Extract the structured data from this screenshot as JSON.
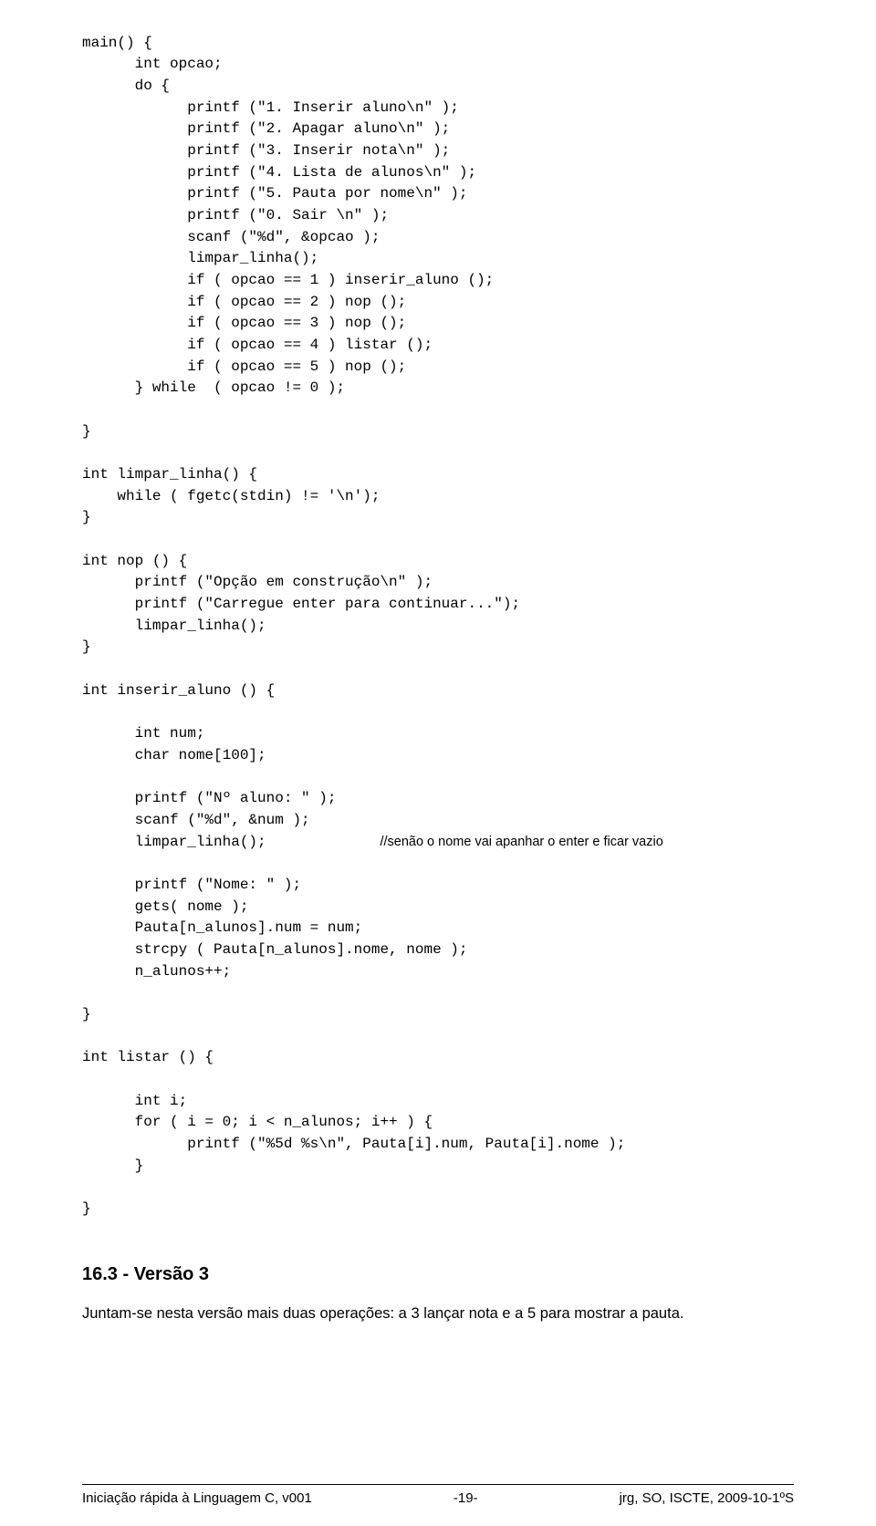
{
  "code": {
    "line01": "main() {",
    "line02": "      int opcao;",
    "line03": "      do {",
    "line04": "            printf (\"1. Inserir aluno\\n\" );",
    "line05": "            printf (\"2. Apagar aluno\\n\" );",
    "line06": "            printf (\"3. Inserir nota\\n\" );",
    "line07": "            printf (\"4. Lista de alunos\\n\" );",
    "line08": "            printf (\"5. Pauta por nome\\n\" );",
    "line09": "            printf (\"0. Sair \\n\" );",
    "line10": "            scanf (\"%d\", &opcao );",
    "line11": "            limpar_linha();",
    "line12": "            if ( opcao == 1 ) inserir_aluno ();",
    "line13": "            if ( opcao == 2 ) nop ();",
    "line14": "            if ( opcao == 3 ) nop ();",
    "line15": "            if ( opcao == 4 ) listar ();",
    "line16": "            if ( opcao == 5 ) nop ();",
    "line17": "      } while  ( opcao != 0 );",
    "line18": "",
    "line19": "}",
    "line20": "",
    "line21": "int limpar_linha() {",
    "line22": "    while ( fgetc(stdin) != '\\n');",
    "line23": "}",
    "line24": "",
    "line25": "int nop () {",
    "line26": "      printf (\"Opção em construção\\n\" );",
    "line27": "      printf (\"Carregue enter para continuar...\");",
    "line28": "      limpar_linha();",
    "line29": "}",
    "line30": "",
    "line31": "int inserir_aluno () {",
    "line32": "",
    "line33": "      int num;",
    "line34": "      char nome[100];",
    "line35": "",
    "line36": "      printf (\"Nº aluno: \" );",
    "line37": "      scanf (\"%d\", &num );",
    "line38a": "      limpar_linha();             ",
    "line38b": "//senão o nome vai apanhar o enter e ficar vazio",
    "line39": "",
    "line40": "      printf (\"Nome: \" );",
    "line41": "      gets( nome );",
    "line42": "      Pauta[n_alunos].num = num;",
    "line43": "      strcpy ( Pauta[n_alunos].nome, nome );",
    "line44": "      n_alunos++;",
    "line45": "",
    "line46": "}",
    "line47": "",
    "line48": "int listar () {",
    "line49": "",
    "line50": "      int i;",
    "line51": "      for ( i = 0; i < n_alunos; i++ ) {",
    "line52": "            printf (\"%5d %s\\n\", Pauta[i].num, Pauta[i].nome );",
    "line53": "      }",
    "line54": "",
    "line55": "}"
  },
  "section": {
    "heading": "16.3 - Versão 3",
    "body": "Juntam-se nesta versão mais duas operações: a 3 lançar nota e a 5 para mostrar a pauta."
  },
  "footer": {
    "left": "Iniciação rápida à Linguagem C, v001",
    "center": "-19-",
    "right": "jrg, SO, ISCTE, 2009-10-1ºS"
  }
}
